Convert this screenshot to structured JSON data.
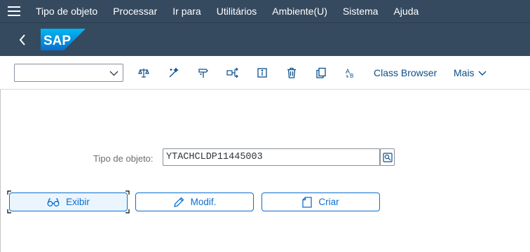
{
  "menubar": {
    "items": [
      "Tipo de objeto",
      "Processar",
      "Ir para",
      "Utilitários",
      "Ambiente(U)",
      "Sistema",
      "Ajuda"
    ]
  },
  "shell": {
    "logo_text": "SAP"
  },
  "toolbar": {
    "select_value": "",
    "class_browser_label": "Class Browser",
    "more_label": "Mais"
  },
  "form": {
    "object_type_label": "Tipo de objeto:",
    "object_type_value": "YTACHCLDP11445003"
  },
  "actions": {
    "display_label": "Exibir",
    "change_label": "Modif.",
    "create_label": "Criar"
  },
  "colors": {
    "shell_bg": "#354a5f",
    "accent": "#0a6ed1",
    "link": "#0a4e8a"
  }
}
